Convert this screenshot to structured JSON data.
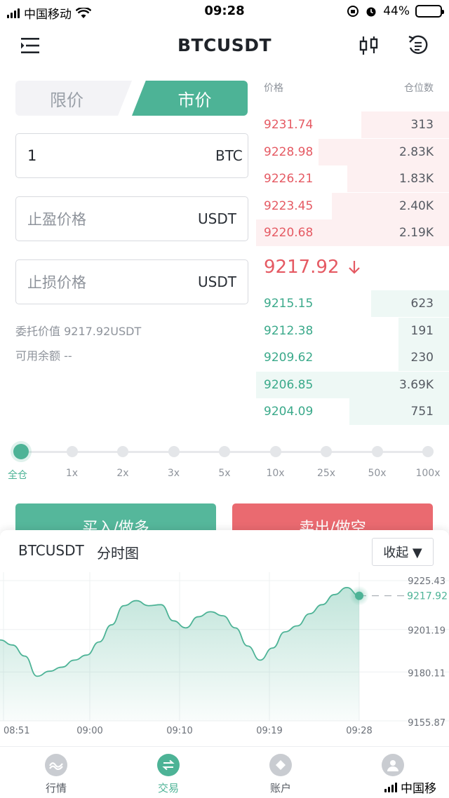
{
  "status_bar": {
    "carrier": "中国移动",
    "time": "09:28",
    "battery": "44%"
  },
  "header": {
    "title": "BTCUSDT"
  },
  "order_type_tabs": {
    "limit": "限价",
    "market": "市价",
    "active": "market"
  },
  "form": {
    "amount": {
      "value": "1",
      "unit": "BTC"
    },
    "take_profit": {
      "placeholder": "止盈价格",
      "unit": "USDT"
    },
    "stop_loss": {
      "placeholder": "止损价格",
      "unit": "USDT"
    },
    "order_value": "委托价值 9217.92USDT",
    "available": "可用余额 --"
  },
  "order_book": {
    "price_header": "价格",
    "size_header": "仓位数",
    "asks": [
      {
        "price": "9231.74",
        "amount": "313",
        "depth": 0.45
      },
      {
        "price": "9228.98",
        "amount": "2.83K",
        "depth": 0.67
      },
      {
        "price": "9226.21",
        "amount": "1.83K",
        "depth": 0.52
      },
      {
        "price": "9223.45",
        "amount": "2.40K",
        "depth": 0.6
      },
      {
        "price": "9220.68",
        "amount": "2.19K",
        "depth": 0.99
      }
    ],
    "last_price": "9217.92",
    "last_direction_icon": "arrow-down-icon",
    "bids": [
      {
        "price": "9215.15",
        "amount": "623",
        "depth": 0.4
      },
      {
        "price": "9212.38",
        "amount": "191",
        "depth": 0.26
      },
      {
        "price": "9209.62",
        "amount": "230",
        "depth": 0.26
      },
      {
        "price": "9206.85",
        "amount": "3.69K",
        "depth": 0.99
      },
      {
        "price": "9204.09",
        "amount": "751",
        "depth": 0.51
      }
    ]
  },
  "leverage": {
    "options": [
      "全仓",
      "1x",
      "2x",
      "3x",
      "5x",
      "10x",
      "25x",
      "50x",
      "100x"
    ],
    "selected": 0
  },
  "actions": {
    "buy": "买入/做多",
    "sell": "卖出/做空"
  },
  "chart_panel": {
    "symbol": "BTCUSDT",
    "mode": "分时图",
    "collapse": "收起 ▼",
    "current_price_label": "9217.92"
  },
  "chart_data": {
    "type": "area",
    "x_ticks": [
      "08:51",
      "09:00",
      "09:10",
      "09:19",
      "09:28"
    ],
    "y_ticks": [
      "9225.43",
      "9201.19",
      "9180.11",
      "9155.87"
    ],
    "ylim": [
      9155.87,
      9225.43
    ],
    "current_price": 9217.92,
    "line_color": "#4db396",
    "values": [
      9196.0,
      9193.5,
      9188.0,
      9178.0,
      9180.5,
      9182.5,
      9186.0,
      9188.5,
      9195.0,
      9203.5,
      9213.0,
      9215.5,
      9213.0,
      9213.5,
      9205.5,
      9202.0,
      9207.5,
      9210.0,
      9208.0,
      9202.0,
      9193.0,
      9186.0,
      9192.0,
      9200.0,
      9203.0,
      9209.0,
      9213.5,
      9218.5,
      9222.0,
      9217.92
    ]
  },
  "tabbar": {
    "items": [
      {
        "label": "行情",
        "icon": "market-icon"
      },
      {
        "label": "交易",
        "icon": "trade-icon"
      },
      {
        "label": "账户",
        "icon": "account-icon"
      },
      {
        "label": "",
        "icon": "profile-icon"
      }
    ],
    "active": 1,
    "overlay_carrier": "中国移"
  },
  "colors": {
    "accent": "#4db396",
    "ask": "#e55a63",
    "bid": "#3aa98a"
  }
}
